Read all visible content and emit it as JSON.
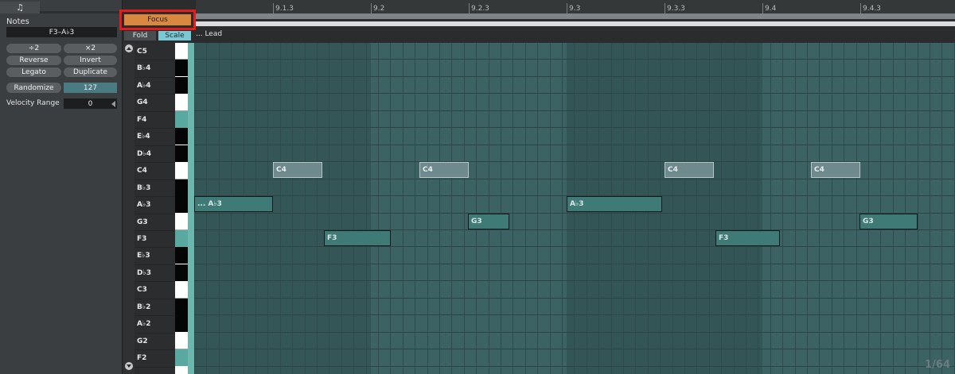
{
  "left_panel": {
    "tab_icon": "music-note-icon",
    "notes_label": "Notes",
    "notes_range": "F3–A♭3",
    "buttons": {
      "halve": "÷2",
      "double": "×2",
      "reverse": "Reverse",
      "invert": "Invert",
      "legato": "Legato",
      "duplicate": "Duplicate"
    },
    "randomize": {
      "label": "Randomize",
      "value": "127"
    },
    "velocity_range": {
      "label": "Velocity Range",
      "value": "0"
    }
  },
  "toolbar": {
    "focus": "Focus",
    "fold": "Fold",
    "scale": "Scale",
    "clip_name": "... Lead"
  },
  "ruler": {
    "labels": [
      "9.1.3",
      "9.2",
      "9.2.3",
      "9.3",
      "9.3.3",
      "9.4",
      "9.4.3"
    ]
  },
  "piano": {
    "labels": [
      "C5",
      "B♭4",
      "A♭4",
      "G4",
      "F4",
      "E♭4",
      "D♭4",
      "C4",
      "B♭3",
      "A♭3",
      "G3",
      "F3",
      "E♭3",
      "D♭3",
      "C3",
      "B♭2",
      "A♭2",
      "G2",
      "F2"
    ]
  },
  "notes": [
    {
      "label": "... A♭3",
      "pitch": "A♭3",
      "style": "teal"
    },
    {
      "label": "C4",
      "pitch": "C4",
      "style": "ghost"
    },
    {
      "label": "F3",
      "pitch": "F3",
      "style": "teal"
    },
    {
      "label": "C4",
      "pitch": "C4",
      "style": "ghost"
    },
    {
      "label": "G3",
      "pitch": "G3",
      "style": "teal"
    },
    {
      "label": "A♭3",
      "pitch": "A♭3",
      "style": "teal"
    },
    {
      "label": "C4",
      "pitch": "C4",
      "style": "ghost"
    },
    {
      "label": "F3",
      "pitch": "F3",
      "style": "teal"
    },
    {
      "label": "C4",
      "pitch": "C4",
      "style": "ghost"
    },
    {
      "label": "G3",
      "pitch": "G3",
      "style": "teal"
    }
  ],
  "grid_label": "1/64",
  "colors": {
    "accent_focus": "#d9883f",
    "scale_button": "#7cc9d6",
    "highlight_box": "#e81b1b",
    "note_fill": "#3f7a76"
  }
}
